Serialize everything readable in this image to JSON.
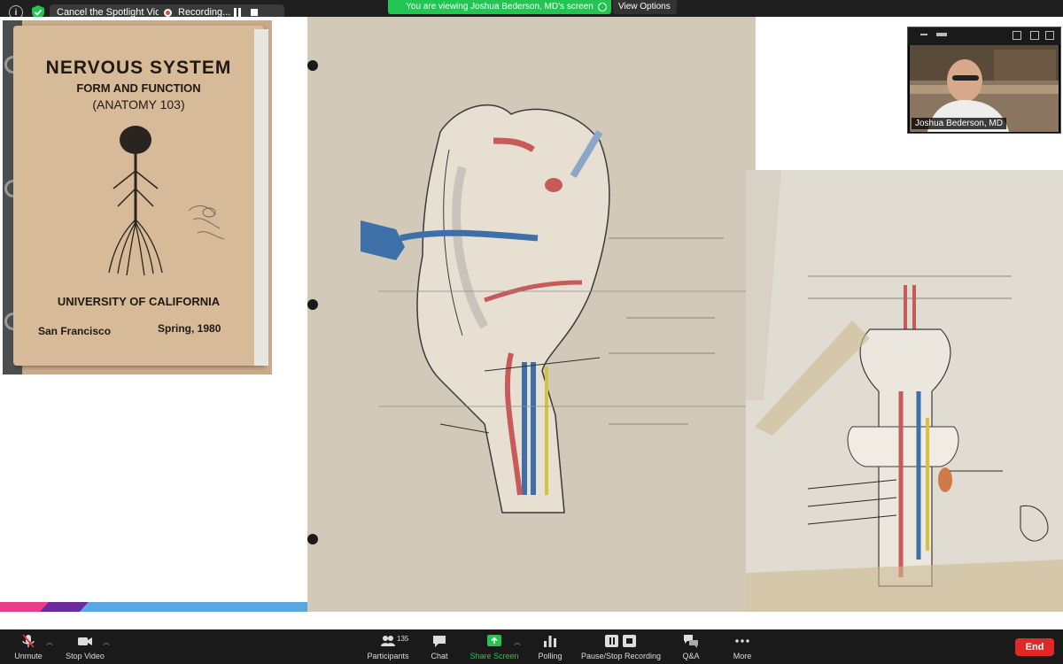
{
  "topbar": {
    "spotlight_label": "Cancel the Spotlight Video",
    "recording_label": "Recording...",
    "viewing_label": "You are viewing Joshua Bederson, MD's screen",
    "view_options_label": "View Options"
  },
  "book": {
    "title": "NERVOUS SYSTEM",
    "subtitle": "FORM AND FUNCTION",
    "course": "(ANATOMY 103)",
    "university": "UNIVERSITY OF CALIFORNIA",
    "city": "San Francisco",
    "term": "Spring, 1980"
  },
  "video": {
    "name": "Joshua Bederson, MD"
  },
  "toolbar": {
    "unmute": "Unmute",
    "stop_video": "Stop Video",
    "participants": "Participants",
    "participants_count": "135",
    "chat": "Chat",
    "share_screen": "Share Screen",
    "polling": "Polling",
    "recording": "Pause/Stop Recording",
    "qa": "Q&A",
    "more": "More",
    "end": "End"
  },
  "colors": {
    "share_green": "#23c552",
    "end_red": "#e02828",
    "toolbar_bg": "#1a1a1a"
  }
}
